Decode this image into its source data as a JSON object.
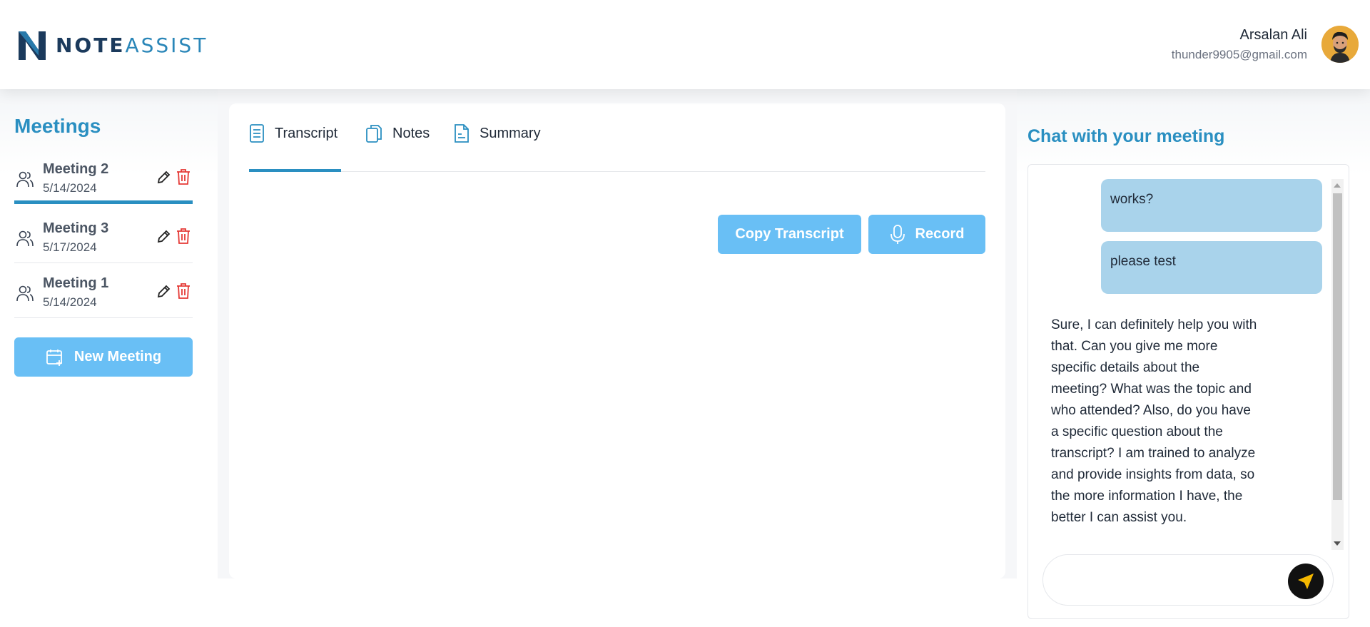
{
  "brand": {
    "logo_letter": "N",
    "name_part1": "NOTE",
    "name_part2": "ASSIST"
  },
  "user": {
    "name": "Arsalan Ali",
    "email": "thunder9905@gmail.com"
  },
  "sidebar": {
    "title": "Meetings",
    "meetings": [
      {
        "name": "Meeting 2",
        "date": "5/14/2024",
        "active": true
      },
      {
        "name": "Meeting 3",
        "date": "5/17/2024",
        "active": false
      },
      {
        "name": "Meeting 1",
        "date": "5/14/2024",
        "active": false
      }
    ],
    "new_meeting_label": "New Meeting"
  },
  "main": {
    "tabs": [
      {
        "label": "Transcript",
        "active": true
      },
      {
        "label": "Notes",
        "active": false
      },
      {
        "label": "Summary",
        "active": false
      }
    ],
    "copy_transcript_label": "Copy Transcript",
    "record_label": "Record"
  },
  "chat": {
    "title": "Chat with your meeting",
    "messages": [
      {
        "role": "user",
        "text": "works?"
      },
      {
        "role": "user",
        "text": "please test"
      },
      {
        "role": "assistant",
        "text": "Sure, I can definitely help you with that. Can you give me more specific details about the meeting? What was the topic and who attended? Also, do you have a specific question about the transcript? I am trained to analyze and provide insights from data, so the more information I have, the better I can assist you."
      }
    ],
    "input_value": "",
    "input_placeholder": ""
  },
  "colors": {
    "accent": "#2a8fc1",
    "button": "#69bff5",
    "user_bubble": "#a9d3eb",
    "delete": "#e53935",
    "send_icon": "#f5b800"
  },
  "icons": {
    "meeting": "users-icon",
    "edit": "pencil-icon",
    "delete": "trash-icon",
    "new_meeting": "calendar-plus-icon",
    "transcript_tab": "document-icon",
    "notes_tab": "copy-icon",
    "summary_tab": "file-text-icon",
    "record": "microphone-icon",
    "send": "send-arrow-icon"
  }
}
